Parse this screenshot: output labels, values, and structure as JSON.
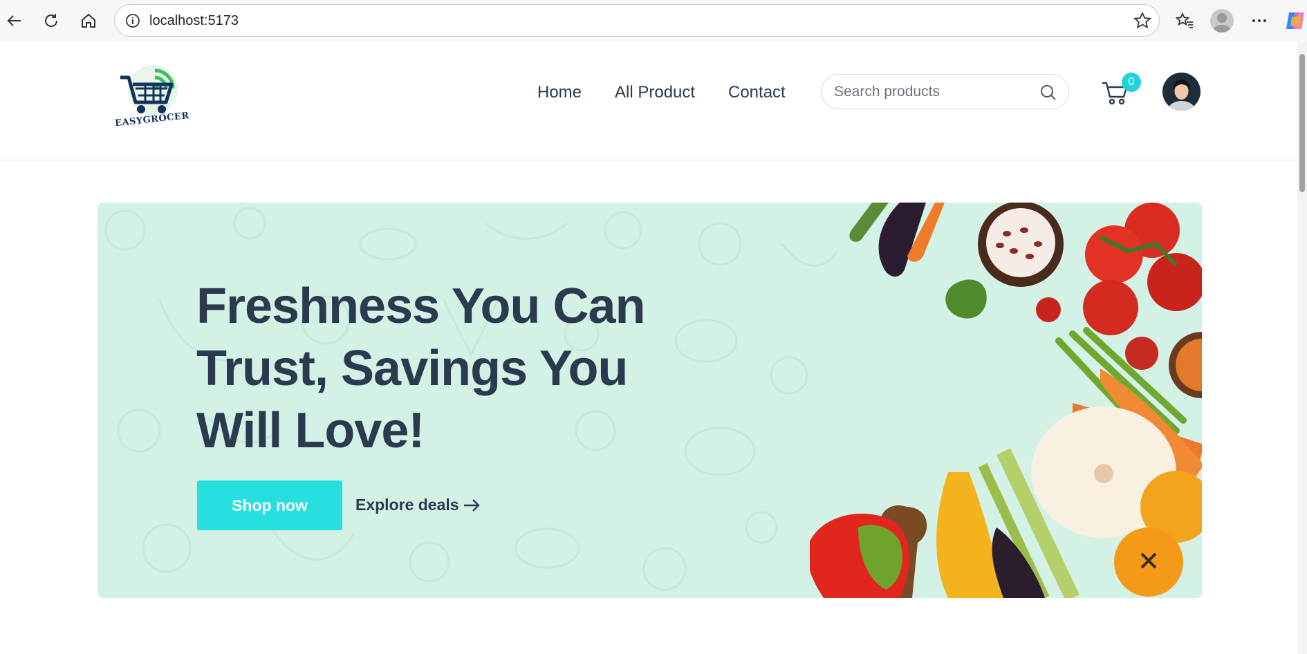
{
  "browser": {
    "url": "localhost:5173",
    "icons": [
      "back-icon",
      "reload-icon",
      "home-icon",
      "info-icon",
      "star-icon",
      "favorites-icon",
      "profile-icon",
      "more-icon",
      "copilot-icon"
    ]
  },
  "header": {
    "logo_text": "EASYGROCER",
    "nav": [
      {
        "label": "Home"
      },
      {
        "label": "All Product"
      },
      {
        "label": "Contact"
      }
    ],
    "search": {
      "placeholder": "Search products",
      "value": ""
    },
    "cart_count": "0"
  },
  "hero": {
    "title": "Freshness You Can Trust, Savings You Will Love!",
    "primary_button": "Shop now",
    "secondary_link": "Explore deals"
  },
  "colors": {
    "accent": "#26e0e0",
    "hero_bg": "#d3f1e5",
    "text_dark": "#2c3a4f"
  }
}
